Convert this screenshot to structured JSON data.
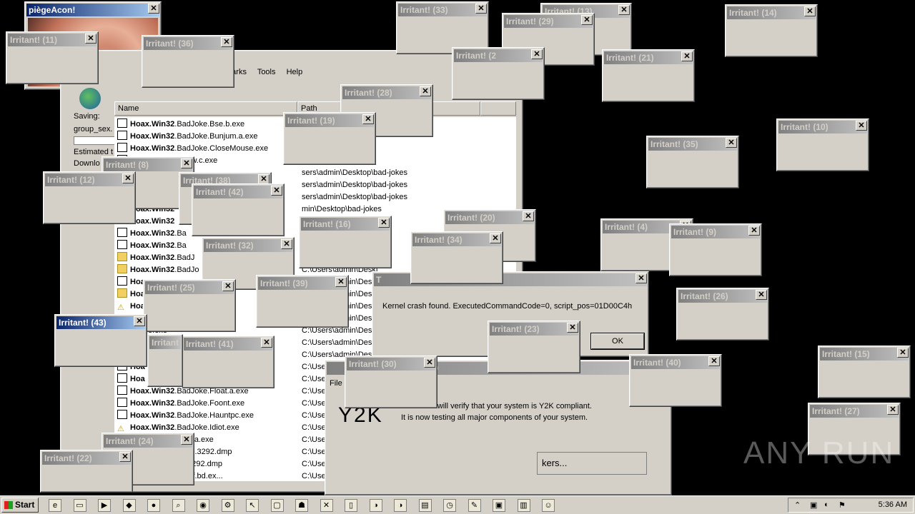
{
  "piege": {
    "title": "piègeAcon!"
  },
  "explorer": {
    "menu": [
      "marks",
      "Tools",
      "Help"
    ],
    "side": {
      "saving": "Saving:",
      "file": "group_sex.",
      "estimated": "Estimated t",
      "download": "Downlo"
    },
    "columns": {
      "name": "Name",
      "path": "Path"
    },
    "rows": [
      {
        "bold": "Hoax.Win32",
        "rest": ".BadJoke.Bse.b.exe",
        "path": "",
        "icon": "exe"
      },
      {
        "bold": "Hoax.Win32",
        "rest": ".BadJoke.Bunjum.a.exe",
        "path": "",
        "icon": "exe"
      },
      {
        "bold": "Hoax.Win32",
        "rest": ".BadJoke.CloseMouse.exe",
        "path": "op\\bad-jokes",
        "icon": "exe"
      },
      {
        "bold": "",
        "rest": "Joke.CloseWindow.c.exe",
        "path": "op\\bad-jokes",
        "icon": "exe"
      },
      {
        "bold": "",
        "rest": "",
        "path": "sers\\admin\\Desktop\\bad-jokes",
        "icon": "none"
      },
      {
        "bold": "",
        "rest": "",
        "path": "sers\\admin\\Desktop\\bad-jokes",
        "icon": "none"
      },
      {
        "bold": "",
        "rest": "",
        "path": "sers\\admin\\Desktop\\bad-jokes",
        "icon": "none"
      },
      {
        "bold": "Hoax.Win32",
        "rest": "",
        "path": "min\\Desktop\\bad-jokes",
        "icon": "none"
      },
      {
        "bold": "Hoax.Win32",
        "rest": "",
        "path": "Desktop\\bad-jokes",
        "icon": "none"
      },
      {
        "bold": "Hoax.Win32",
        "rest": ".Ba",
        "path": "",
        "icon": "exe"
      },
      {
        "bold": "Hoax.Win32",
        "rest": ".Ba",
        "path": "",
        "icon": "exe"
      },
      {
        "bold": "Hoax.Win32",
        "rest": ".BadJ",
        "path": "",
        "icon": "folder"
      },
      {
        "bold": "Hoax.Win32",
        "rest": ".BadJo",
        "path": "C:\\Users\\admin\\Deskt",
        "icon": "folder"
      },
      {
        "bold": "Hoa",
        "rest": "",
        "path": "C:\\Users\\admin\\Desk",
        "icon": "exe"
      },
      {
        "bold": "Hoa",
        "rest": "",
        "path": "C:\\Users\\admin\\Desk",
        "icon": "folder"
      },
      {
        "bold": "Hoa",
        "rest": "",
        "path": "C:\\Users\\admin\\Desk",
        "icon": "warn"
      },
      {
        "bold": "",
        "rest": "",
        "path": "C:\\Users\\admin\\Desk",
        "icon": "none"
      },
      {
        "bold": "",
        "rest": "rmat.e.exe",
        "path": "C:\\Users\\admin\\Desk",
        "icon": "none"
      },
      {
        "bold": "",
        "rest": "",
        "path": "C:\\Users\\admin\\Desk",
        "icon": "none"
      },
      {
        "bold": "",
        "rest": "",
        "path": "C:\\Users\\admin\\Desk",
        "icon": "none"
      },
      {
        "bold": "Hoa",
        "rest": "",
        "path": "C:\\Use",
        "icon": "exe"
      },
      {
        "bold": "Hoa",
        "rest": "",
        "path": "C:\\Use",
        "icon": "exe"
      },
      {
        "bold": "Hoax.Win32",
        "rest": ".BadJoke.Float.a.exe",
        "path": "C:\\Use",
        "icon": "exe"
      },
      {
        "bold": "Hoax.Win32",
        "rest": ".BadJoke.Foont.exe",
        "path": "C:\\Use",
        "icon": "exe"
      },
      {
        "bold": "Hoax.Win32",
        "rest": ".BadJoke.Hauntpc.exe",
        "path": "C:\\Use",
        "icon": "exe"
      },
      {
        "bold": "Hoax.Win32",
        "rest": ".BadJoke.Idiot.exe",
        "path": "C:\\Use",
        "icon": "warn"
      },
      {
        "bold": "",
        "rest": "Joke.InvertMouse.a.exe",
        "path": "C:\\Use",
        "icon": "none"
      },
      {
        "bold": "",
        "rest": "Joke.VB.ad.exe(1).3292.dmp",
        "path": "C:\\Use",
        "icon": "none"
      },
      {
        "bold": "",
        "rest": "Joke.VB.ad.exe.3292.dmp",
        "path": "C:\\Use",
        "icon": "none"
      },
      {
        "bold": "in32",
        "rest": ".BadJoke.Delf.bd.ex...",
        "path": "C:\\Use",
        "icon": "none"
      }
    ]
  },
  "crash": {
    "title": "T",
    "message": "Kernel crash found. ExecutedCommandCode=0, script_pos=01D00C4h",
    "ok": "OK"
  },
  "irritants": [
    {
      "id": "irr-11",
      "title": "Irritant! (11)"
    },
    {
      "id": "irr-36",
      "title": "Irritant! (36)"
    },
    {
      "id": "irr-33",
      "title": "Irritant! (33)"
    },
    {
      "id": "irr-13",
      "title": "Irritant! (13)"
    },
    {
      "id": "irr-29",
      "title": "Irritant! (29)"
    },
    {
      "id": "irr-2",
      "title": "Irritant! (2"
    },
    {
      "id": "irr-21",
      "title": "Irritant! (21)"
    },
    {
      "id": "irr-14",
      "title": "Irritant! (14)"
    },
    {
      "id": "irr-28",
      "title": "Irritant! (28)"
    },
    {
      "id": "irr-19",
      "title": "Irritant! (19)"
    },
    {
      "id": "irr-10",
      "title": "Irritant! (10)"
    },
    {
      "id": "irr-35",
      "title": "Irritant! (35)"
    },
    {
      "id": "irr-8",
      "title": "Irritant! (8)"
    },
    {
      "id": "irr-12",
      "title": "Irritant! (12)"
    },
    {
      "id": "irr-38",
      "title": "Irritant! (38)"
    },
    {
      "id": "irr-42",
      "title": "Irritant! (42)"
    },
    {
      "id": "irr-16",
      "title": "Irritant! (16)"
    },
    {
      "id": "irr-20",
      "title": "Irritant! (20)"
    },
    {
      "id": "irr-34",
      "title": "Irritant! (34)"
    },
    {
      "id": "irr-4",
      "title": "Irritant! (4)"
    },
    {
      "id": "irr-9",
      "title": "Irritant! (9)"
    },
    {
      "id": "irr-32",
      "title": "Irritant! (32)"
    },
    {
      "id": "irr-39",
      "title": "Irritant! (39)"
    },
    {
      "id": "irr-25",
      "title": "Irritant! (25)"
    },
    {
      "id": "irr-26",
      "title": "Irritant! (26)"
    },
    {
      "id": "irr-43",
      "title": "Irritant! (43)"
    },
    {
      "id": "irr-23",
      "title": "Irritant! (23)"
    },
    {
      "id": "irr-41",
      "title": "Irritant! (41)"
    },
    {
      "id": "irr-30",
      "title": "Irritant! (30)"
    },
    {
      "id": "irr-40",
      "title": "Irritant! (40)"
    },
    {
      "id": "irr-15",
      "title": "Irritant! (15)"
    },
    {
      "id": "irr-27",
      "title": "Irritant! (27)"
    },
    {
      "id": "irr-24",
      "title": "Irritant! (24)"
    },
    {
      "id": "irr-22",
      "title": "Irritant! (22)"
    },
    {
      "id": "irr-x",
      "title": "Irritant"
    }
  ],
  "y2k": {
    "menu": "File",
    "title_suffix": "00",
    "line1": "n checker will verify that your system is Y2K compliant.",
    "line2": "It is now testing all major components of your system.",
    "logo": "Y2K",
    "checkers": "kers..."
  },
  "watermark": "ANY RUN",
  "taskbar": {
    "start": "Start",
    "clock": "5:36 AM",
    "quick_icons": [
      "ie-icon",
      "folder-icon",
      "media-icon",
      "app-icon",
      "stop-icon",
      "magnifier-icon",
      "eye-icon",
      "gear-icon",
      "cursor-icon",
      "window-icon",
      "ghost-icon",
      "x-icon",
      "doc-icon",
      "moon-icon",
      "moon-icon",
      "toolbar-icon",
      "clock-icon",
      "notepad-icon",
      "gift-icon",
      "book-icon",
      "smiley-icon"
    ]
  }
}
